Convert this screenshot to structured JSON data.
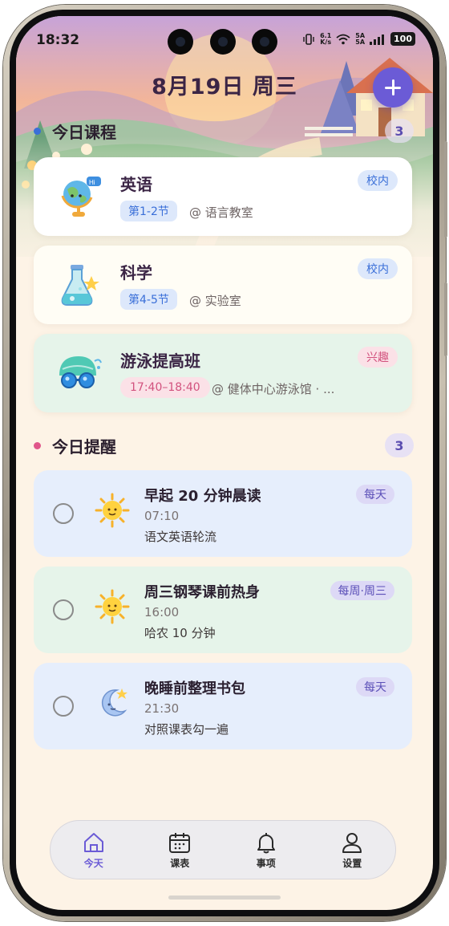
{
  "status_bar": {
    "time": "18:32",
    "net_speed_top": "6.1",
    "net_speed_bottom": "K/s",
    "signal_top": "5A",
    "signal_bottom": "5A",
    "battery": "100"
  },
  "header": {
    "date_title": "8月19日 周三",
    "add_icon": "plus-icon"
  },
  "courses_section": {
    "title": "今日课程",
    "count": "3",
    "accent": "#3a6fd8",
    "items": [
      {
        "name": "英语",
        "tag": "校内",
        "period": "第1-2节",
        "location": "@ 语言教室",
        "icon": "globe-icon",
        "bg": "#ffffff"
      },
      {
        "name": "科学",
        "tag": "校内",
        "period": "第4-5节",
        "location": "@ 实验室",
        "icon": "flask-icon",
        "bg": "#fffdf5"
      },
      {
        "name": "游泳提高班",
        "tag": "兴趣",
        "period": "17:40–18:40",
        "location": "@ 健体中心游泳馆 · ...",
        "icon": "swim-cap-goggles-icon",
        "bg": "#e6f4ea"
      }
    ]
  },
  "reminders_section": {
    "title": "今日提醒",
    "count": "3",
    "accent": "#e0568a",
    "items": [
      {
        "title": "早起 20 分钟晨读",
        "time": "07:10",
        "note": "语文英语轮流",
        "repeat": "每天",
        "icon": "sun-icon",
        "bg": "#e6eefc"
      },
      {
        "title": "周三钢琴课前热身",
        "time": "16:00",
        "note": "哈农 10 分钟",
        "repeat": "每周·周三",
        "icon": "sun-icon",
        "bg": "#e6f4ea"
      },
      {
        "title": "晚睡前整理书包",
        "time": "21:30",
        "note": "对照课表勾一遍",
        "repeat": "每天",
        "icon": "moon-icon",
        "bg": "#e6eefc"
      }
    ]
  },
  "tab_bar": {
    "tabs": [
      {
        "label": "今天",
        "icon": "home-icon",
        "active": true
      },
      {
        "label": "课表",
        "icon": "calendar-icon",
        "active": false
      },
      {
        "label": "事项",
        "icon": "bell-icon",
        "active": false
      },
      {
        "label": "设置",
        "icon": "person-icon",
        "active": false
      }
    ]
  },
  "colors": {
    "primary": "#6b5bd6",
    "school_tag_bg": "#dde8fb",
    "school_tag_text": "#3a6fd8",
    "interest_tag_bg": "#fbe1e7",
    "interest_tag_text": "#d2527e"
  }
}
